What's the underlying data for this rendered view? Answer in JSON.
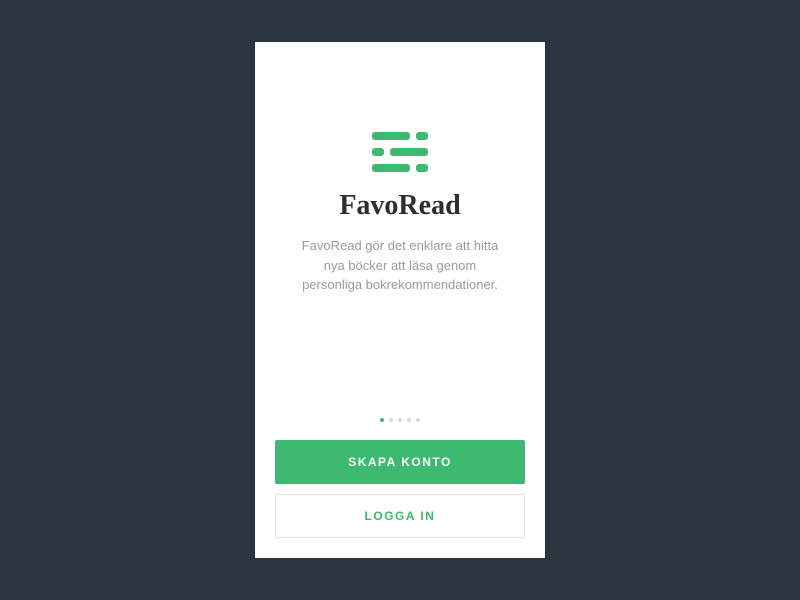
{
  "app": {
    "name": "FavoRead",
    "description": "FavoRead gör det enklare att hitta nya böcker att läsa genom personliga bokrekommendationer."
  },
  "onboarding": {
    "current_page": 1,
    "total_pages": 5
  },
  "buttons": {
    "create_account": "SKAPA KONTO",
    "login": "LOGGA IN"
  },
  "colors": {
    "primary": "#3eb971",
    "background": "#2c3640",
    "text_muted": "#9b9b9b"
  }
}
